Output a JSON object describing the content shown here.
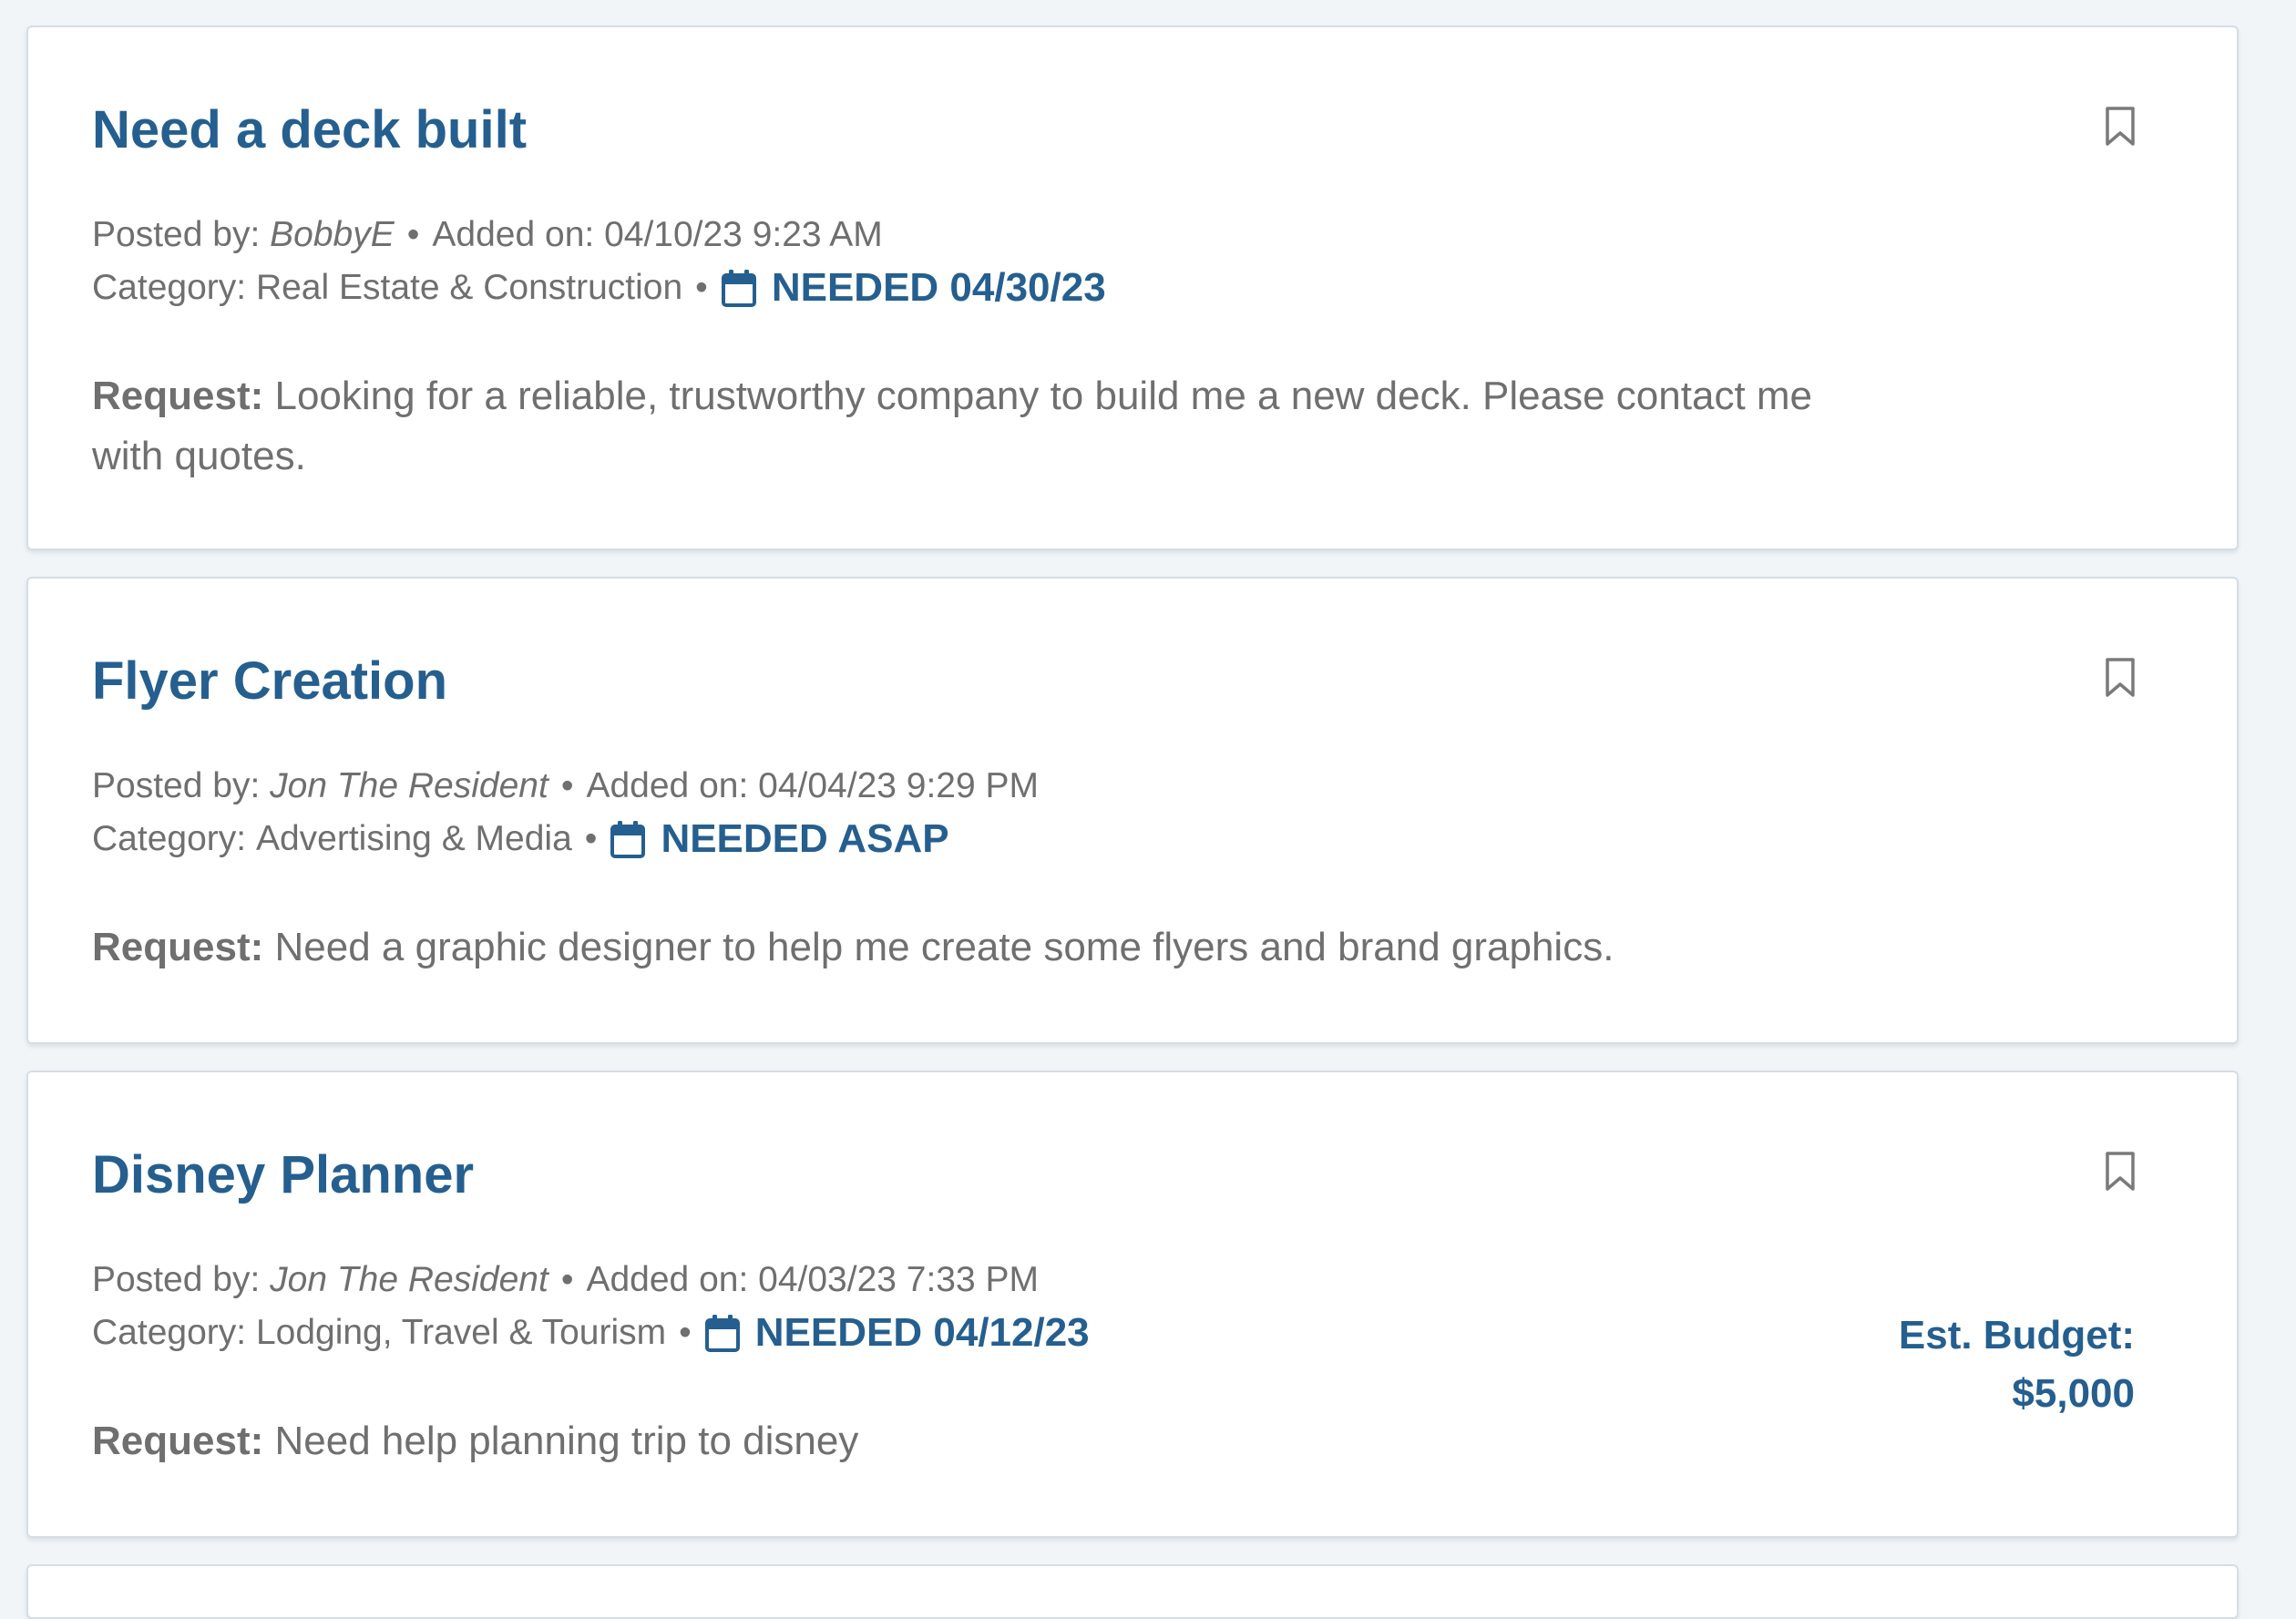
{
  "colors": {
    "accent": "#255f8f",
    "text_muted": "#6f6f6f",
    "background": "#f1f5f8",
    "card_border": "#d5dde5"
  },
  "labels": {
    "posted_by": "Posted by:",
    "added_on": "Added on:",
    "category": "Category:",
    "request": "Request:",
    "separator": "•",
    "est_budget": "Est. Budget:"
  },
  "icons": {
    "bookmark": "bookmark-icon",
    "calendar": "calendar-icon"
  },
  "posts": [
    {
      "title": "Need a deck built",
      "author": "BobbyE",
      "added_on": "04/10/23 9:23 AM",
      "category": "Real Estate & Construction",
      "needed": "NEEDED 04/30/23",
      "request": "Looking for a reliable, trustworthy company to build me a new deck. Please contact me with quotes."
    },
    {
      "title": "Flyer Creation",
      "author": "Jon The Resident",
      "added_on": "04/04/23 9:29 PM",
      "category": "Advertising & Media",
      "needed": "NEEDED ASAP",
      "request": "Need a graphic designer to help me create some flyers and brand graphics."
    },
    {
      "title": "Disney Planner",
      "author": "Jon The Resident",
      "added_on": "04/03/23 7:33 PM",
      "category": "Lodging, Travel & Tourism",
      "needed": "NEEDED 04/12/23",
      "request": "Need help planning trip to disney",
      "budget": "$5,000"
    }
  ]
}
